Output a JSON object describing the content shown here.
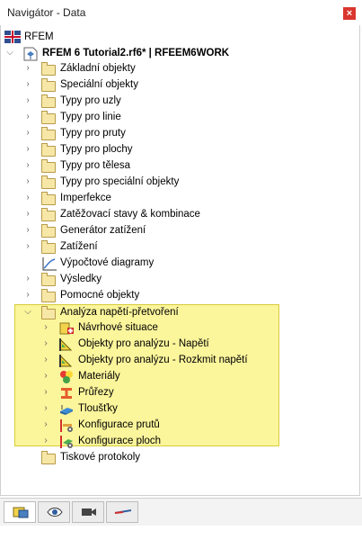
{
  "window": {
    "title": "Navigátor - Data",
    "close_label": "×"
  },
  "root": {
    "label": "RFEM"
  },
  "project": {
    "label": "RFEM 6 Tutorial2.rf6* | RFEEM6WORK"
  },
  "items": [
    "Základní objekty",
    "Speciální objekty",
    "Typy pro uzly",
    "Typy pro linie",
    "Typy pro pruty",
    "Typy pro plochy",
    "Typy pro tělesa",
    "Typy pro speciální objekty",
    "Imperfekce",
    "Zatěžovací stavy & kombinace",
    "Generátor zatížení",
    "Zatížení",
    "Výpočtové diagramy",
    "Výsledky",
    "Pomocné objekty",
    "Analýza napětí-přetvoření"
  ],
  "stress": [
    "Návrhové situace",
    "Objekty pro analýzu - Napětí",
    "Objekty pro analýzu - Rozkmit napětí",
    "Materiály",
    "Průřezy",
    "Tloušťky",
    "Konfigurace prutů",
    "Konfigurace ploch"
  ],
  "last": {
    "label": "Tiskové protokoly"
  },
  "colors": {
    "highlight": "#fbf59b",
    "highlight_border": "#d8cb3a",
    "folder": "#f7e7a6"
  },
  "bottom_tabs": [
    "data-icon",
    "eye-icon",
    "camera-icon",
    "results-icon"
  ]
}
